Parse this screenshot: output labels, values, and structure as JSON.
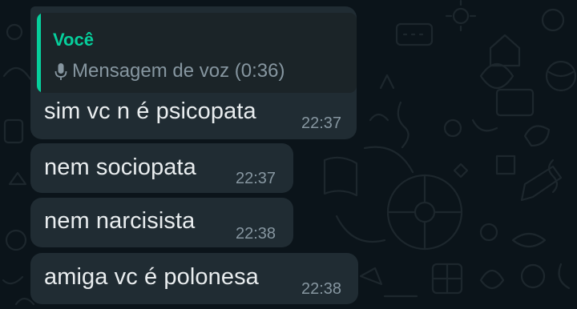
{
  "theme": {
    "background": "#0b141a",
    "bubble": "#202c33",
    "quote_background": "#1b2428",
    "accent": "#06cf9c",
    "text": "#e9edef",
    "meta_text": "#8696a0"
  },
  "quoted_message": {
    "author": "Você",
    "icon": "microphone-icon",
    "text": "Mensagem de voz (0:36)"
  },
  "messages": [
    {
      "text": "sim vc n é psicopata",
      "time": "22:37"
    },
    {
      "text": "nem sociopata",
      "time": "22:37"
    },
    {
      "text": "nem narcisista",
      "time": "22:38"
    },
    {
      "text": "amiga vc é polonesa",
      "time": "22:38"
    }
  ]
}
